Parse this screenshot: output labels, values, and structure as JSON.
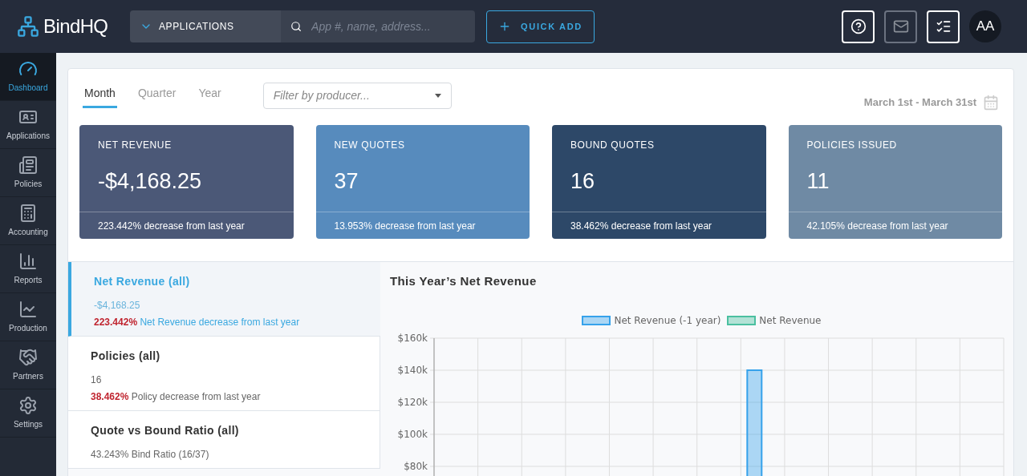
{
  "header": {
    "logo": "BindHQ",
    "scope": "APPLICATIONS",
    "search": {
      "placeholder": "App #, name, address..."
    },
    "quick_add": "QUICK ADD",
    "icon_buttons": [
      {
        "kind": "help",
        "disabled": false
      },
      {
        "kind": "mail",
        "disabled": true
      },
      {
        "kind": "tasks",
        "disabled": false
      }
    ],
    "avatar": "AA"
  },
  "sidebar": {
    "items": [
      {
        "kind": "dashboard",
        "label": "Dashboard",
        "selected": true
      },
      {
        "kind": "applications",
        "label": "Applications",
        "selected": false
      },
      {
        "kind": "policies",
        "label": "Policies",
        "selected": false
      },
      {
        "kind": "accounting",
        "label": "Accounting",
        "selected": false
      },
      {
        "kind": "reports",
        "label": "Reports",
        "selected": false
      },
      {
        "kind": "production",
        "label": "Production",
        "selected": false
      },
      {
        "kind": "partners",
        "label": "Partners",
        "selected": false
      },
      {
        "kind": "settings",
        "label": "Settings",
        "selected": false
      }
    ]
  },
  "period_tabs": [
    {
      "label": "Month",
      "selected": true
    },
    {
      "label": "Quarter",
      "selected": false
    },
    {
      "label": "Year",
      "selected": false
    }
  ],
  "producer_filter": {
    "placeholder": "Filter by producer..."
  },
  "date_range": "March 1st - March 31st",
  "stat_cards": [
    {
      "title": "NET REVENUE",
      "value": "-$4,168.25",
      "note": "223.442% decrease from last year",
      "color": "#4b5877"
    },
    {
      "title": "NEW QUOTES",
      "value": "37",
      "note": "13.953% decrease from last year",
      "color": "#578bbd"
    },
    {
      "title": "BOUND QUOTES",
      "value": "16",
      "note": "38.462% decrease from last year",
      "color": "#2d4868"
    },
    {
      "title": "POLICIES ISSUED",
      "value": "11",
      "note": "42.105% decrease from last year",
      "color": "#6f8aa4"
    }
  ],
  "reports": [
    {
      "title": "Net Revenue (all)",
      "value": "-$4,168.25",
      "change": "223.442%",
      "change_text": "Net Revenue decrease from last year",
      "selected": true
    },
    {
      "title": "Policies (all)",
      "value": "16",
      "change": "38.462%",
      "change_text": "Policy decrease from last year",
      "selected": false
    },
    {
      "title": "Quote vs Bound Ratio (all)",
      "value": "43.243% Bind Ratio (16/37)",
      "selected": false
    }
  ],
  "chart": {
    "title": "This Year’s Net Revenue",
    "legend": [
      {
        "name": "Net Revenue (-1 year)",
        "color": "#36a2eb"
      },
      {
        "name": "Net Revenue",
        "color": "#4bc0a0"
      }
    ],
    "y_axis_labels": [
      "$160k",
      "$140k",
      "$120k",
      "$100k",
      "$80k"
    ]
  }
}
